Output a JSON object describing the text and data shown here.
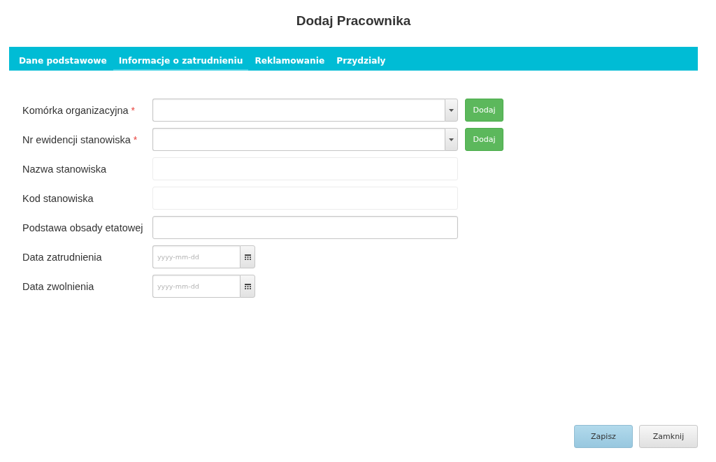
{
  "window": {
    "title": "Dodaj Pracownika"
  },
  "tabs": [
    {
      "label": "Dane podstawowe",
      "selected": false
    },
    {
      "label": "Informacje o zatrudnieniu",
      "selected": true
    },
    {
      "label": "Reklamowanie",
      "selected": false
    },
    {
      "label": "Przydzialy",
      "selected": false
    }
  ],
  "form": {
    "fields": [
      {
        "label": "Komórka organizacyjna",
        "required_mark": "*",
        "kind": "select",
        "disabled": false,
        "add_button": "Dodaj"
      },
      {
        "label": "Nr ewidencji stanowiska",
        "required_mark": "*",
        "kind": "select",
        "disabled": false,
        "add_button": "Dodaj"
      },
      {
        "label": "Nazwa stanowiska",
        "kind": "text",
        "disabled": true
      },
      {
        "label": "Kod stanowiska",
        "kind": "text",
        "disabled": true
      },
      {
        "label": "Podstawa obsady etatowej",
        "kind": "text",
        "disabled": false
      },
      {
        "label": "Data zatrudnienia",
        "kind": "date",
        "disabled": false,
        "placeholder": "yyyy-mm-dd"
      },
      {
        "label": "Data zwolnienia",
        "kind": "date",
        "disabled": false,
        "placeholder": "yyyy-mm-dd"
      }
    ]
  },
  "buttons": [
    {
      "label": "Zapisz",
      "kind": "primary"
    },
    {
      "label": "Zamknij",
      "kind": "default"
    }
  ]
}
